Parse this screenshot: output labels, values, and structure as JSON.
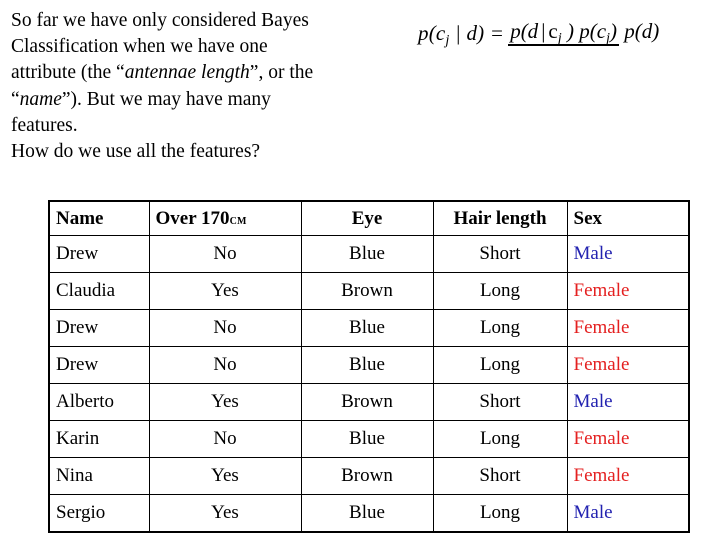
{
  "intro": {
    "line1": "So far we have only considered Bayes",
    "line2": "Classification when we have one",
    "line3_pre": "attribute (the “",
    "line3_italic": "antennae length",
    "line3_post": "”, or the",
    "line4_pre": "“",
    "line4_italic": "name",
    "line4_post": "”). But we may have many",
    "line5": "features.",
    "line6": "How do we use all the features?"
  },
  "formula": {
    "lhs": "p(c",
    "lhs_sub": "j",
    "lhs_tail": " | d) =",
    "num_p1": "p(d",
    "num_bar": "|",
    "num_c": "c",
    "num_c_sub": "j",
    "num_close": " ) ",
    "num_p2": "p(c",
    "num_p2_sub": "j",
    "num_p2_close": ")",
    "denominator": "p(d)",
    "alt_text": "p(cj | d) = p(d | cj) p(cj) / p(d)"
  },
  "table": {
    "headers": {
      "name": "Name",
      "over_main": "Over 170",
      "over_unit": "cm",
      "eye": "Eye",
      "hair": "Hair length",
      "sex": "Sex"
    },
    "rows": [
      {
        "name": "Drew",
        "over": "No",
        "eye": "Blue",
        "hair": "Short",
        "sex": "Male",
        "sex_class": "sex-male"
      },
      {
        "name": "Claudia",
        "over": "Yes",
        "eye": "Brown",
        "hair": "Long",
        "sex": "Female",
        "sex_class": "sex-female"
      },
      {
        "name": "Drew",
        "over": "No",
        "eye": "Blue",
        "hair": "Long",
        "sex": "Female",
        "sex_class": "sex-female"
      },
      {
        "name": "Drew",
        "over": "No",
        "eye": "Blue",
        "hair": "Long",
        "sex": "Female",
        "sex_class": "sex-female"
      },
      {
        "name": "Alberto",
        "over": "Yes",
        "eye": "Brown",
        "hair": "Short",
        "sex": "Male",
        "sex_class": "sex-male"
      },
      {
        "name": "Karin",
        "over": "No",
        "eye": "Blue",
        "hair": "Long",
        "sex": "Female",
        "sex_class": "sex-female"
      },
      {
        "name": "Nina",
        "over": "Yes",
        "eye": "Brown",
        "hair": "Short",
        "sex": "Female",
        "sex_class": "sex-female"
      },
      {
        "name": "Sergio",
        "over": "Yes",
        "eye": "Blue",
        "hair": "Long",
        "sex": "Male",
        "sex_class": "sex-male"
      }
    ]
  },
  "colors": {
    "male": "#2222b0",
    "female": "#e42020",
    "text": "#000000",
    "background": "#ffffff",
    "border": "#000000"
  }
}
